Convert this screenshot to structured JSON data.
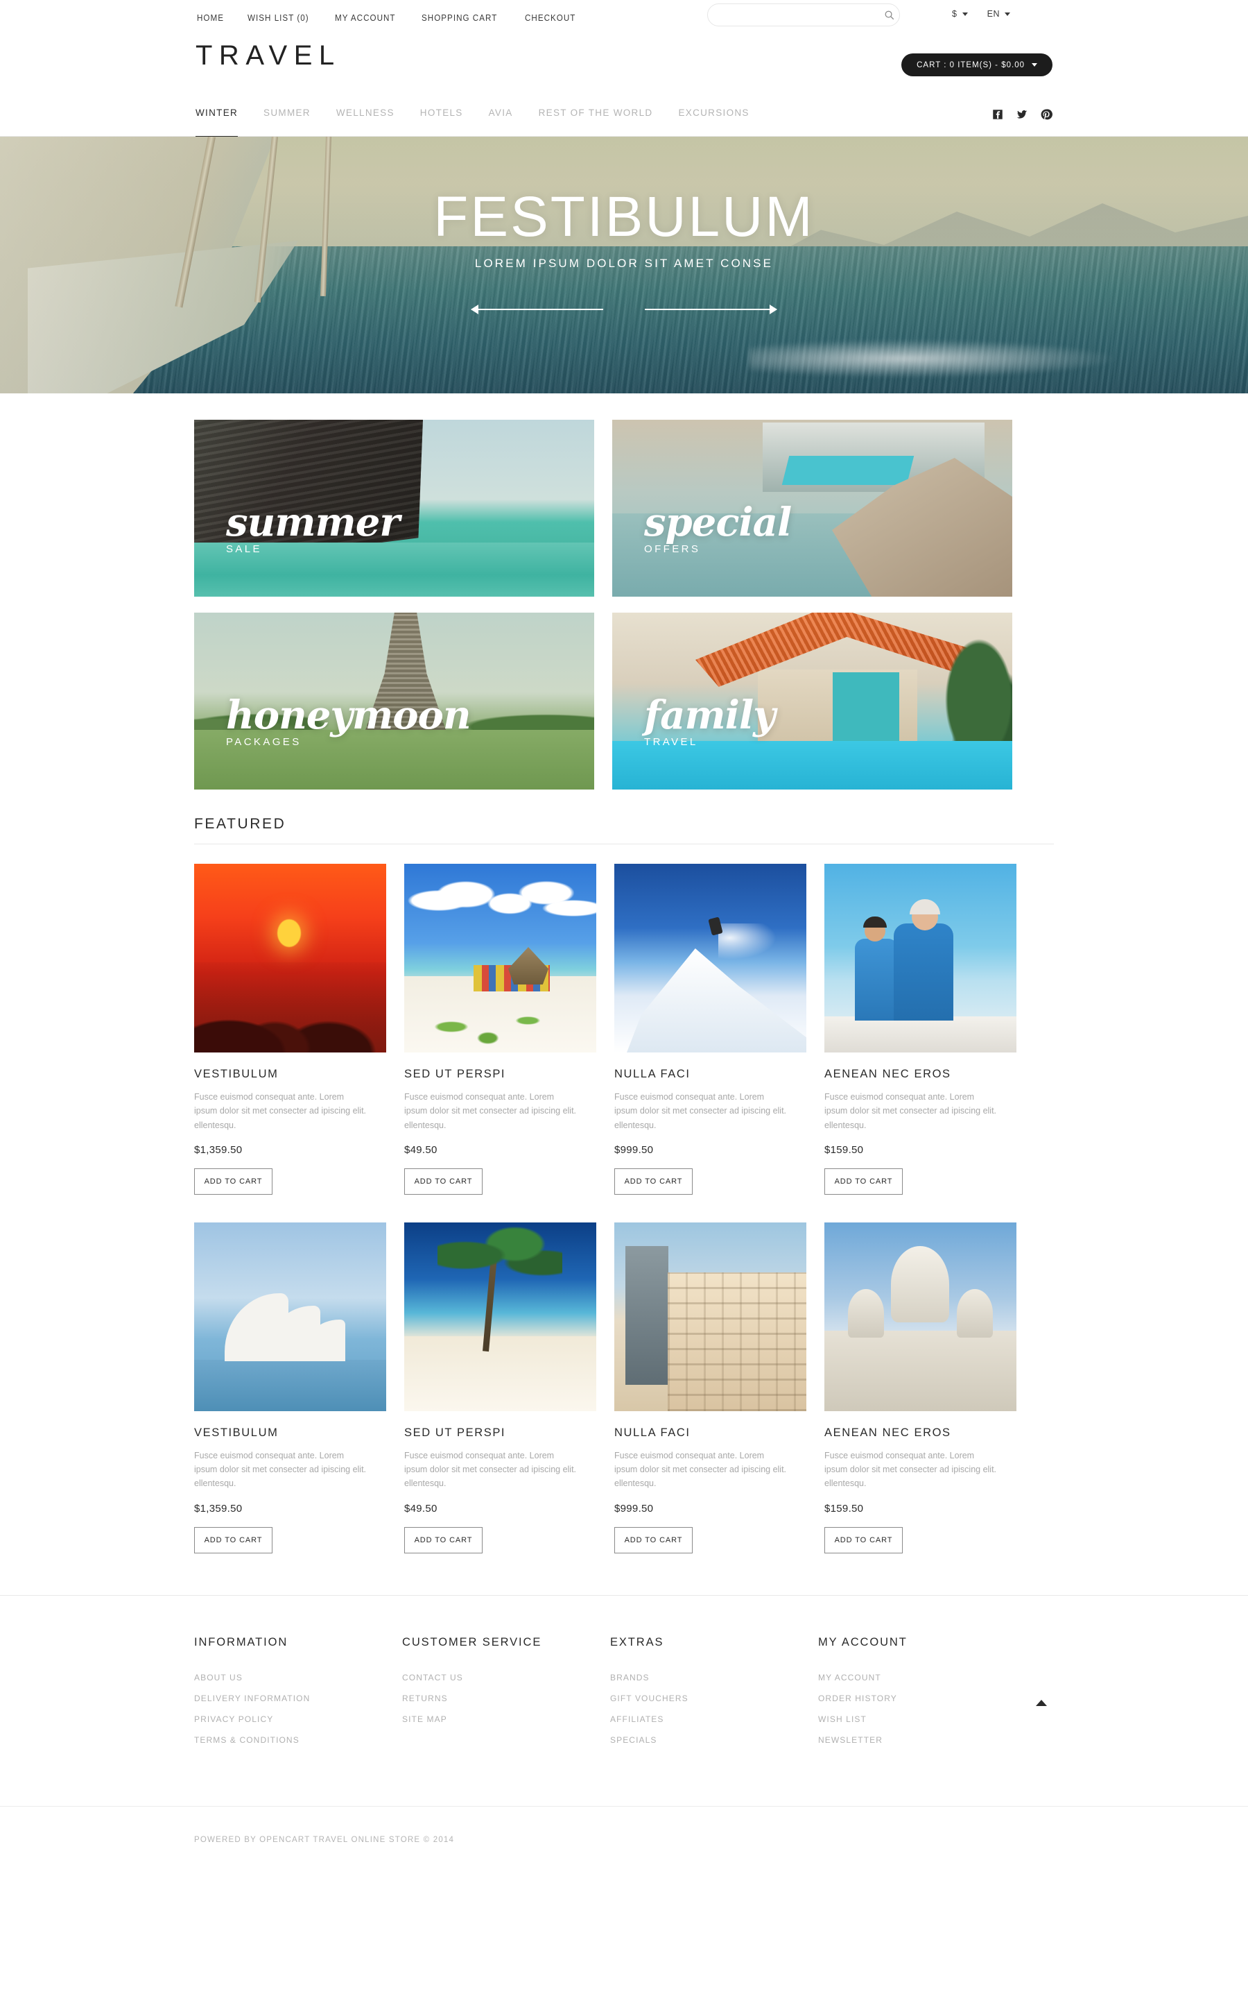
{
  "topbar": {
    "links": [
      {
        "label": "HOME",
        "name": "home"
      },
      {
        "label": "WISH LIST (0)",
        "name": "wish-list"
      },
      {
        "label": "MY ACCOUNT",
        "name": "my-account"
      },
      {
        "label": "SHOPPING CART",
        "name": "shopping-cart"
      },
      {
        "label": "CHECKOUT",
        "name": "checkout"
      }
    ],
    "search": {
      "value": "",
      "placeholder": "",
      "icon": "search-icon"
    },
    "currency": {
      "label": "$",
      "icon": "chevron-down-icon"
    },
    "language": {
      "label": "EN",
      "icon": "chevron-down-icon"
    }
  },
  "header": {
    "logo": "TRAVEL",
    "cart": {
      "label": "CART : 0 ITEM(S) - $0.00",
      "icon": "chevron-down-icon"
    }
  },
  "nav": {
    "items": [
      {
        "label": "WINTER",
        "active": true
      },
      {
        "label": "SUMMER",
        "active": false
      },
      {
        "label": "WELLNESS",
        "active": false
      },
      {
        "label": "HOTELS",
        "active": false
      },
      {
        "label": "AVIA",
        "active": false
      },
      {
        "label": "REST OF THE WORLD",
        "active": false
      },
      {
        "label": "EXCURSIONS",
        "active": false
      }
    ],
    "socials": [
      {
        "name": "facebook-icon",
        "label": "Facebook"
      },
      {
        "name": "twitter-icon",
        "label": "Twitter"
      },
      {
        "name": "pinterest-icon",
        "label": "Pinterest"
      }
    ]
  },
  "hero": {
    "title": "FESTIBULUM",
    "subtitle": "LOREM IPSUM DOLOR SIT AMET CONSE",
    "prev_label": "Previous slide",
    "next_label": "Next slide"
  },
  "promos": [
    {
      "script": "summer",
      "sub": "SALE",
      "art": "p-summer"
    },
    {
      "script": "special",
      "sub": "OFFERS",
      "art": "p-special"
    },
    {
      "script": "honeymoon",
      "sub": "PACKAGES",
      "art": "p-honeymoon"
    },
    {
      "script": "family",
      "sub": "TRAVEL",
      "art": "p-family"
    }
  ],
  "featured": {
    "title": "FEATURED",
    "add_to_cart_label": "ADD TO CART",
    "row1": [
      {
        "name": "VESTIBULUM",
        "desc": "Fusce euismod consequat ante. Lorem ipsum dolor sit met consecter ad ipiscing elit. ellentesqu.",
        "price": "$1,359.50",
        "art": "a-sunset"
      },
      {
        "name": "SED UT PERSPI",
        "desc": "Fusce euismod consequat ante. Lorem ipsum dolor sit met consecter ad ipiscing elit. ellentesqu.",
        "price": "$49.50",
        "art": "a-beach"
      },
      {
        "name": "NULLA FACI",
        "desc": "Fusce euismod consequat ante. Lorem ipsum dolor sit met consecter ad ipiscing elit. ellentesqu.",
        "price": "$999.50",
        "art": "a-snow"
      },
      {
        "name": "AENEAN NEC EROS",
        "desc": "Fusce euismod consequat ante. Lorem ipsum dolor sit met consecter ad ipiscing elit. ellentesqu.",
        "price": "$159.50",
        "art": "a-boat"
      }
    ],
    "row2": [
      {
        "name": "VESTIBULUM",
        "desc": "Fusce euismod consequat ante. Lorem ipsum dolor sit met consecter ad ipiscing elit. ellentesqu.",
        "price": "$1,359.50",
        "art": "a-opera"
      },
      {
        "name": "SED UT PERSPI",
        "desc": "Fusce euismod consequat ante. Lorem ipsum dolor sit met consecter ad ipiscing elit. ellentesqu.",
        "price": "$49.50",
        "art": "a-palm"
      },
      {
        "name": "NULLA FACI",
        "desc": "Fusce euismod consequat ante. Lorem ipsum dolor sit met consecter ad ipiscing elit. ellentesqu.",
        "price": "$999.50",
        "art": "a-hotel"
      },
      {
        "name": "AENEAN NEC EROS",
        "desc": "Fusce euismod consequat ante. Lorem ipsum dolor sit met consecter ad ipiscing elit. ellentesqu.",
        "price": "$159.50",
        "art": "a-church"
      }
    ]
  },
  "footer": {
    "columns": [
      {
        "title": "INFORMATION",
        "links": [
          "ABOUT US",
          "DELIVERY INFORMATION",
          "PRIVACY POLICY",
          "TERMS & CONDITIONS"
        ]
      },
      {
        "title": "CUSTOMER SERVICE",
        "links": [
          "CONTACT US",
          "RETURNS",
          "SITE MAP"
        ]
      },
      {
        "title": "EXTRAS",
        "links": [
          "BRANDS",
          "GIFT VOUCHERS",
          "AFFILIATES",
          "SPECIALS"
        ]
      },
      {
        "title": "MY ACCOUNT",
        "links": [
          "MY ACCOUNT",
          "ORDER HISTORY",
          "WISH LIST",
          "NEWSLETTER"
        ]
      }
    ],
    "scroll_top_icon": "chevron-up-icon",
    "copyright": "POWERED BY OPENCART TRAVEL ONLINE STORE © 2014"
  },
  "colors": {
    "text_dark": "#2a2a2a",
    "text_muted": "#b0b0b0",
    "cart_bg": "#1c1c1c",
    "border": "#e8e8e8"
  }
}
